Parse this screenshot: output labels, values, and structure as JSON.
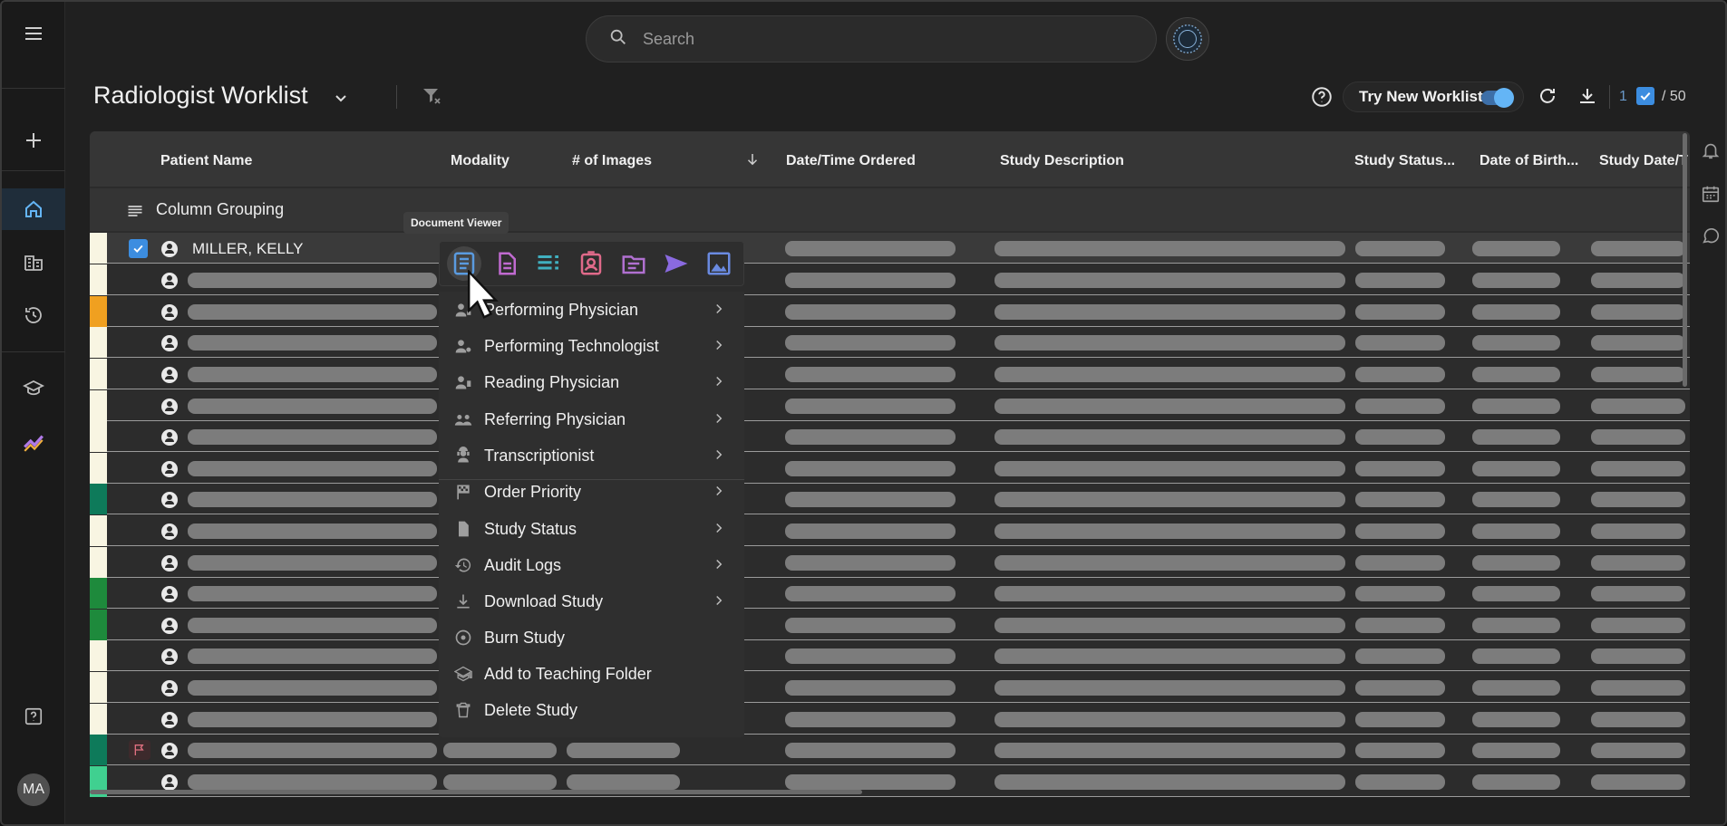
{
  "search": {
    "placeholder": "Search"
  },
  "header": {
    "title": "Radiologist Worklist",
    "try_new_worklist": "Try New Worklist",
    "try_new_worklist_on": true,
    "selected_count": "1",
    "total_count": "/ 50"
  },
  "columns": [
    "Patient Name",
    "Modality",
    "# of Images",
    "Date/Time Ordered",
    "Study Description",
    "Study Status...",
    "Date of Birth...",
    "Study Date/T"
  ],
  "grouping": {
    "label": "Column Grouping"
  },
  "first_row": {
    "patient_name": "MILLER, KELLY",
    "selected": true
  },
  "row_band_colors": [
    "#f8f5e2",
    "#f8f5e2",
    "#f0a020",
    "#f8f5e2",
    "#f8f5e2",
    "#f8f5e2",
    "#f8f5e2",
    "#f8f5e2",
    "#0e7a5a",
    "#f8f5e2",
    "#f8f5e2",
    "#1e8a3c",
    "#1e8a3c",
    "#f8f5e2",
    "#f8f5e2",
    "#f8f5e2",
    "#0e7a5a",
    "#40d090"
  ],
  "tooltip": "Document Viewer",
  "toolbar_icons": [
    {
      "name": "document-viewer-icon",
      "color": "#5a9be0"
    },
    {
      "name": "report-icon",
      "color": "#c06ad0"
    },
    {
      "name": "list-details-icon",
      "color": "#40b0c0"
    },
    {
      "name": "patient-card-icon",
      "color": "#e06a8a"
    },
    {
      "name": "folder-icon",
      "color": "#b070d0"
    },
    {
      "name": "send-icon",
      "color": "#8a6ae0"
    },
    {
      "name": "image-icon",
      "color": "#6a8ae0"
    }
  ],
  "menu_items": [
    {
      "label": "Performing Physician",
      "icon": "physician-icon",
      "submenu": true
    },
    {
      "label": "Performing Technologist",
      "icon": "technologist-icon",
      "submenu": true
    },
    {
      "label": "Reading Physician",
      "icon": "reading-physician-icon",
      "submenu": true
    },
    {
      "label": "Referring Physician",
      "icon": "referring-physician-icon",
      "submenu": true
    },
    {
      "label": "Transcriptionist",
      "icon": "transcriptionist-icon",
      "submenu": true
    },
    {
      "label": "Order Priority",
      "icon": "checkered-flag-icon",
      "submenu": true
    },
    {
      "label": "Study Status",
      "icon": "document-icon",
      "submenu": true
    },
    {
      "label": "Audit Logs",
      "icon": "history-icon",
      "submenu": true
    },
    {
      "label": "Download Study",
      "icon": "download-icon",
      "submenu": true
    },
    {
      "label": "Burn Study",
      "icon": "disc-icon",
      "submenu": false
    },
    {
      "label": "Add to Teaching Folder",
      "icon": "school-icon",
      "submenu": false
    },
    {
      "label": "Delete Study",
      "icon": "trash-icon",
      "submenu": false
    }
  ],
  "avatar": "MA"
}
